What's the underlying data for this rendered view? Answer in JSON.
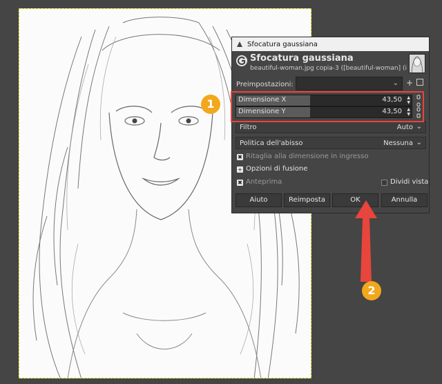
{
  "dialog": {
    "window_title": "Sfocatura gaussiana",
    "header_title": "Sfocatura gaussiana",
    "header_subtitle": "beautiful-woman.jpg copia-3 ([beautiful-woman] (i...",
    "presets_label": "Preimpostazioni:",
    "presets_value": "",
    "size_x": {
      "label": "Dimensione X",
      "value": "43,50"
    },
    "size_y": {
      "label": "Dimensione Y",
      "value": "43,50"
    },
    "filter": {
      "label": "Filtro",
      "value": "Auto"
    },
    "abyss_policy": {
      "label": "Politica dell'abisso",
      "value": "Nessuna"
    },
    "clip_to_input": {
      "label": "Ritaglia alla dimensione in ingresso",
      "checked": true
    },
    "blending_options": {
      "label": "Opzioni di fusione"
    },
    "preview": {
      "label": "Anteprima",
      "checked": true
    },
    "split_view": {
      "label": "Dividi vista",
      "checked": false
    },
    "buttons": {
      "help": "Aiuto",
      "reset": "Reimposta",
      "ok": "OK",
      "cancel": "Annulla"
    }
  },
  "annotations": {
    "badge_1": "1",
    "badge_2": "2",
    "color": "#f2a81d",
    "highlight_color": "#e8453c"
  }
}
